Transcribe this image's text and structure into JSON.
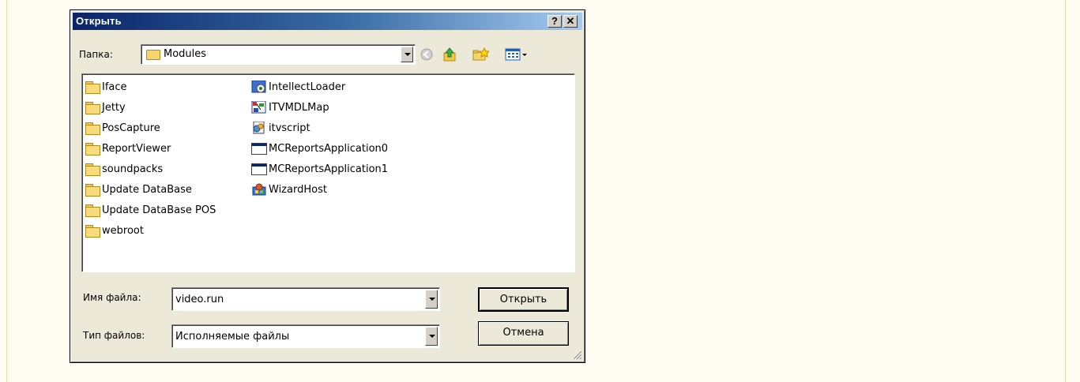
{
  "dialog": {
    "title": "Открыть",
    "help_button": "?",
    "close_button": "✕"
  },
  "location": {
    "label": "Папка:",
    "value": "Modules"
  },
  "toolbar": {
    "icons": [
      "back-icon",
      "up-folder-icon",
      "new-folder-icon",
      "view-menu-icon"
    ]
  },
  "files": {
    "folders": [
      "Iface",
      "Jetty",
      "PosCapture",
      "ReportViewer",
      "soundpacks",
      "Update DataBase",
      "Update DataBase POS",
      "webroot"
    ],
    "programs": [
      "IntellectLoader",
      "ITVMDLMap",
      "itvscript",
      "MCReportsApplication0",
      "MCReportsApplication1",
      "WizardHost"
    ]
  },
  "filename": {
    "label": "Имя файла:",
    "value": "video.run"
  },
  "filetype": {
    "label": "Тип файлов:",
    "value": "Исполняемые файлы"
  },
  "buttons": {
    "open": "Открыть",
    "cancel": "Отмена"
  },
  "colors": {
    "titlebar_start": "#0a246a",
    "titlebar_end": "#a6caf0",
    "dialog_bg": "#ece9d8",
    "page_bg": "#fffcf2"
  }
}
